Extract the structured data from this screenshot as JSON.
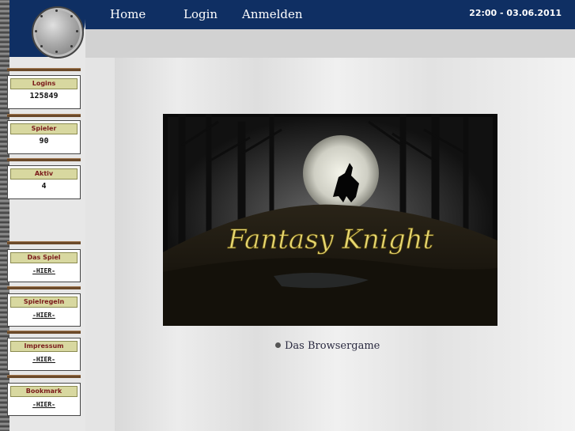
{
  "nav": {
    "home": "Home",
    "login": "Login",
    "register": "Anmelden"
  },
  "clock": "22:00 - 03.06.2011",
  "stats": [
    {
      "label": "Logins",
      "value": "125849"
    },
    {
      "label": "Spieler",
      "value": "90"
    },
    {
      "label": "Aktiv",
      "value": "4"
    }
  ],
  "links": [
    {
      "label": "Das Spiel",
      "link": "-HIER-"
    },
    {
      "label": "Spielregeln",
      "link": "-HIER-"
    },
    {
      "label": "Impressum",
      "link": "-HIER-"
    },
    {
      "label": "Bookmark",
      "link": "-HIER-"
    }
  ],
  "banner": {
    "title": "Fantasy Knight"
  },
  "caption": "Das Browsergame",
  "colors": {
    "header": "#0f2f63",
    "label_bg": "#d8d8a0",
    "label_text": "#7a1a1a",
    "banner_title": "#e8d870"
  }
}
